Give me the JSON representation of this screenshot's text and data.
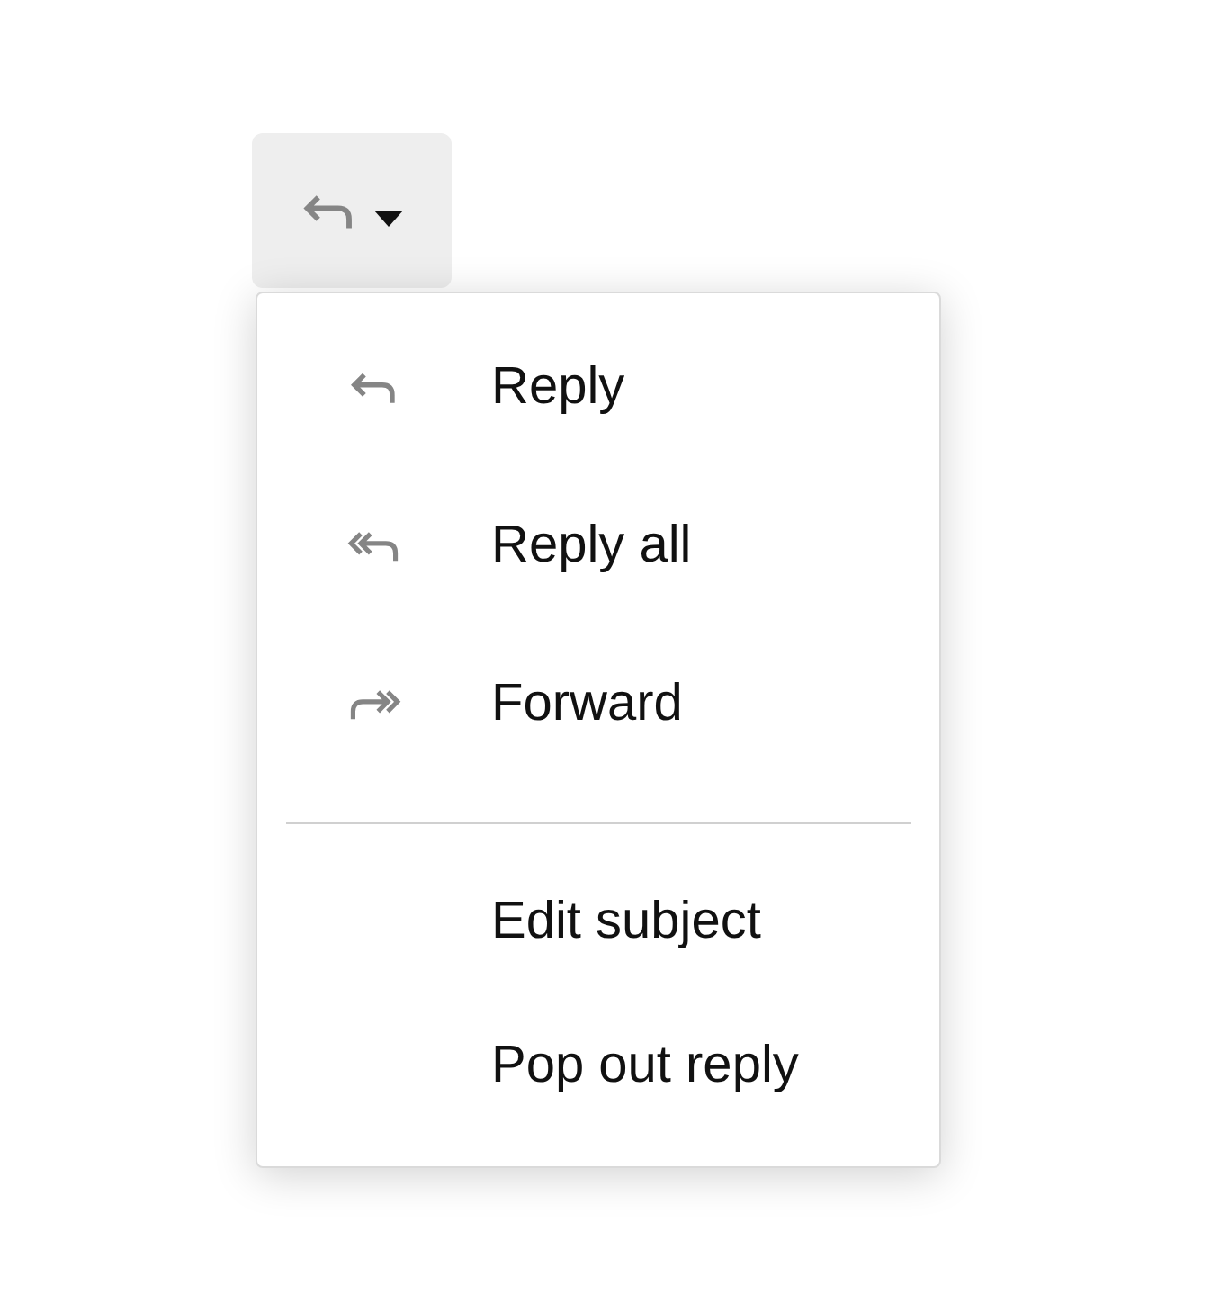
{
  "button": {
    "kind": "reply"
  },
  "menu": {
    "sections": [
      [
        {
          "kind": "reply",
          "label": "Reply"
        },
        {
          "kind": "reply_all",
          "label": "Reply all"
        },
        {
          "kind": "forward",
          "label": "Forward"
        }
      ],
      [
        {
          "kind": "plain",
          "label": "Edit subject"
        },
        {
          "kind": "plain",
          "label": "Pop out reply"
        }
      ]
    ]
  }
}
